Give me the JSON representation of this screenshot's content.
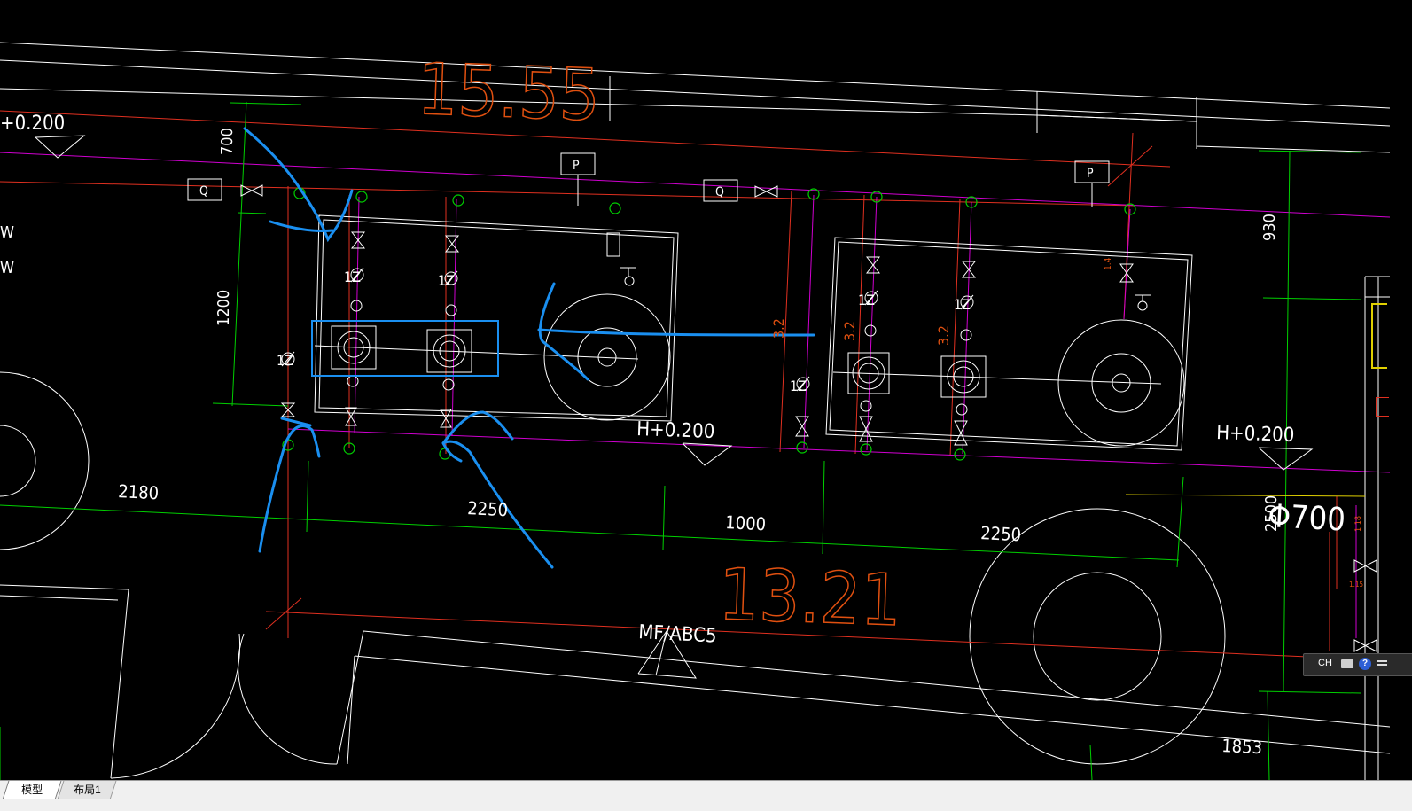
{
  "tabs": {
    "model": "模型",
    "layout1": "布局1"
  },
  "ime": {
    "lang": "CH",
    "help": "?"
  },
  "drawing": {
    "elev_top": "15.55",
    "elev_bottom": "13.21",
    "h_left": "+0.200",
    "h_mid": "H+0.200",
    "h_right": "H+0.200",
    "dim_700": "700",
    "dim_1200": "1200",
    "dim_930": "930",
    "dim_2180": "2180",
    "dim_2250a": "2250",
    "dim_1000": "1000",
    "dim_2250b": "2250",
    "dim_2500": "2500",
    "dim_1853": "1853",
    "phi_700": "Φ700",
    "mf_label": "MF/ABC5",
    "q_label": "Q",
    "p_label": "P",
    "w_label": "W",
    "slope_32": "3.2",
    "slope_14": "1.4",
    "dim_118": "1.18",
    "dim_115": "1.15",
    "valve_1z": "1Z"
  },
  "colors": {
    "background": "#000000",
    "cad_white": "#ffffff",
    "cad_red": "#e03020",
    "cad_magenta": "#d000d0",
    "cad_green": "#00d000",
    "cad_orange": "#e05010",
    "annotation_blue": "#1a8ff0",
    "cad_yellow": "#e0d000"
  }
}
